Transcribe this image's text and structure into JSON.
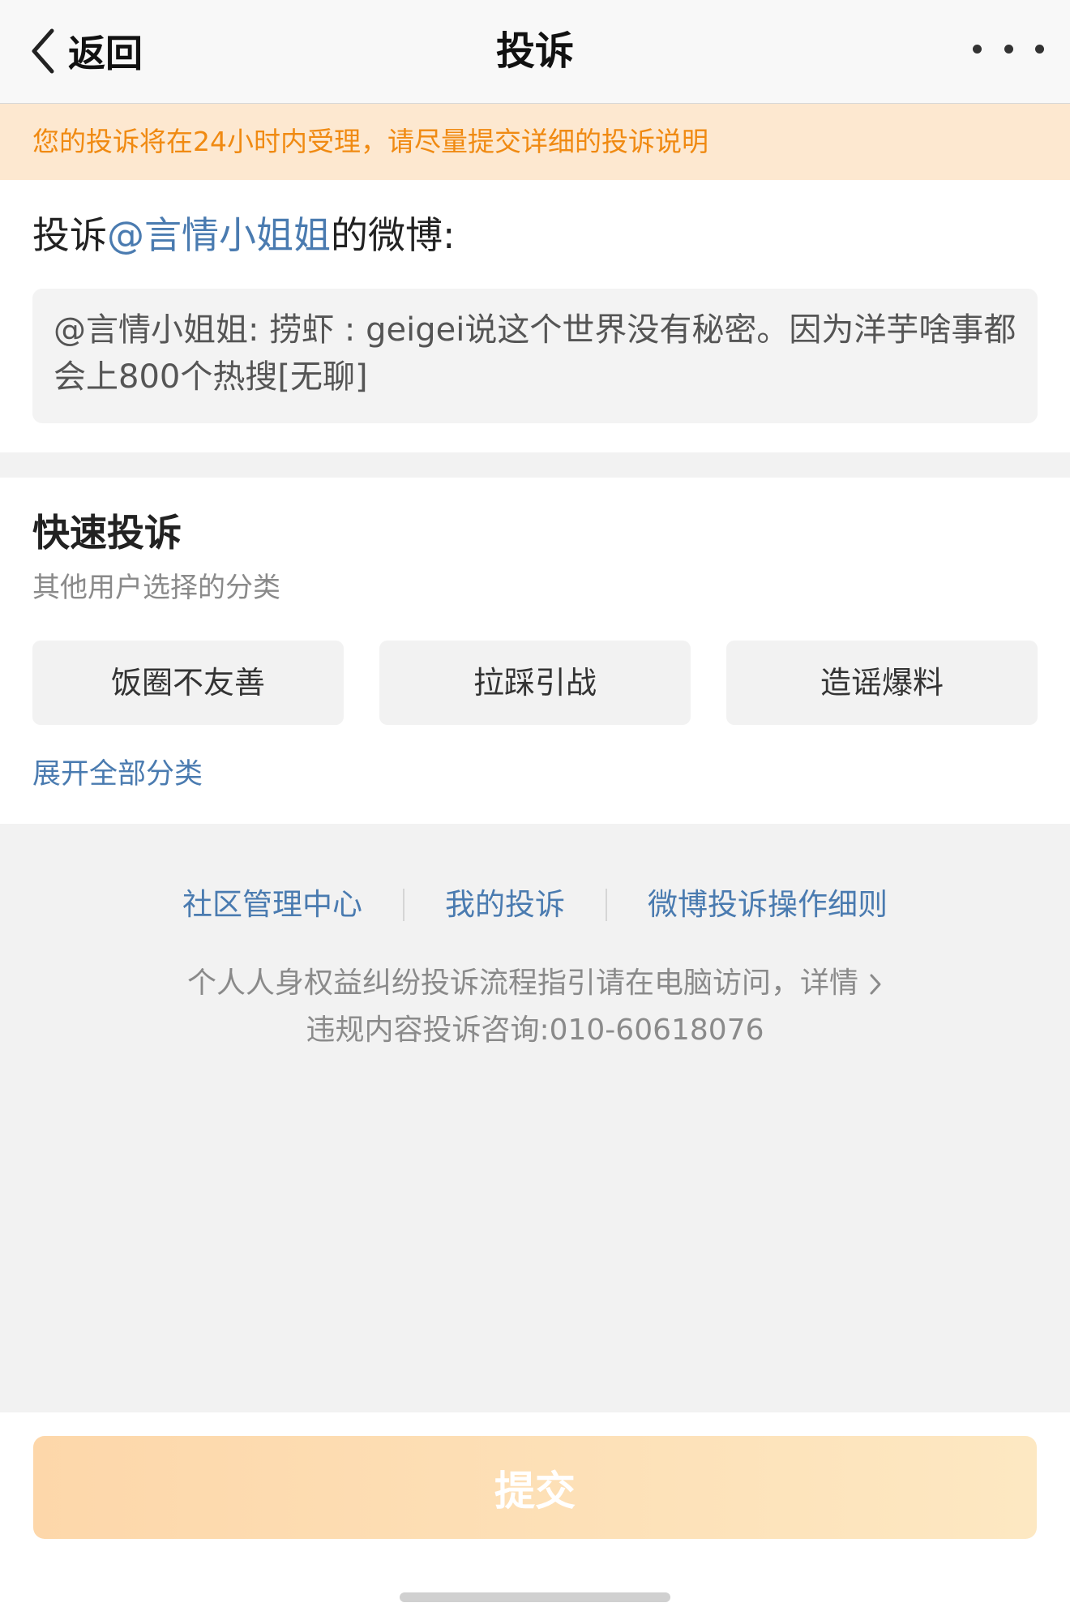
{
  "nav": {
    "back_label": "返回",
    "title": "投诉"
  },
  "notice": {
    "text": "您的投诉将在24小时内受理，请尽量提交详细的投诉说明"
  },
  "target": {
    "prefix": "投诉",
    "user": "@言情小姐姐",
    "suffix": "的微博:",
    "quote_text": "@言情小姐姐:  捞虾 : geigei说这个世界没有秘密。因为洋芋啥事都会上800个热搜[无聊]"
  },
  "quick": {
    "title": "快速投诉",
    "subtitle": "其他用户选择的分类",
    "chips": [
      "饭圈不友善",
      "拉踩引战",
      "造谣爆料"
    ],
    "expand_label": "展开全部分类"
  },
  "links": [
    "社区管理中心",
    "我的投诉",
    "微博投诉操作细则"
  ],
  "info": {
    "line1": "个人人身权益纠纷投诉流程指引请在电脑访问，详情",
    "line2": "违规内容投诉咨询:010-60618076"
  },
  "footer": {
    "submit_label": "提交"
  },
  "colors": {
    "accent_link": "#4a7bb0",
    "notice_text": "#f08a12",
    "notice_bg": "#fde8d0",
    "submit_gradient_start": "#fdd7aa",
    "submit_gradient_end": "#fde8c2"
  }
}
